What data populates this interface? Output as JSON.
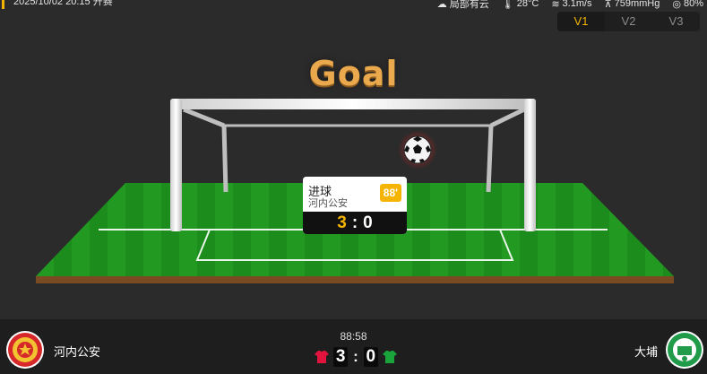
{
  "header": {
    "match_time": "2025/10/02 20:15 开赛",
    "weather": "局部有云",
    "temperature": "28°C",
    "wind": "3.1m/s",
    "pressure": "759mmHg",
    "humidity": "80%"
  },
  "tabs": [
    {
      "label": "V1",
      "active": true
    },
    {
      "label": "V2",
      "active": false
    },
    {
      "label": "V3",
      "active": false
    }
  ],
  "animation": {
    "title": "Goal"
  },
  "event": {
    "type": "进球",
    "team": "河内公安",
    "minute": "88'",
    "home_score": "3",
    "away_score": "0",
    "separator": ":"
  },
  "footer": {
    "clock": "88:58",
    "home_team": "河内公安",
    "away_team": "大埔",
    "home_score": "3",
    "away_score": "0",
    "separator": ":"
  },
  "colors": {
    "accent": "#f5b400",
    "home_kit": "#e0143c",
    "away_kit": "#1aa33a",
    "pitch": "#1e8b1e"
  }
}
